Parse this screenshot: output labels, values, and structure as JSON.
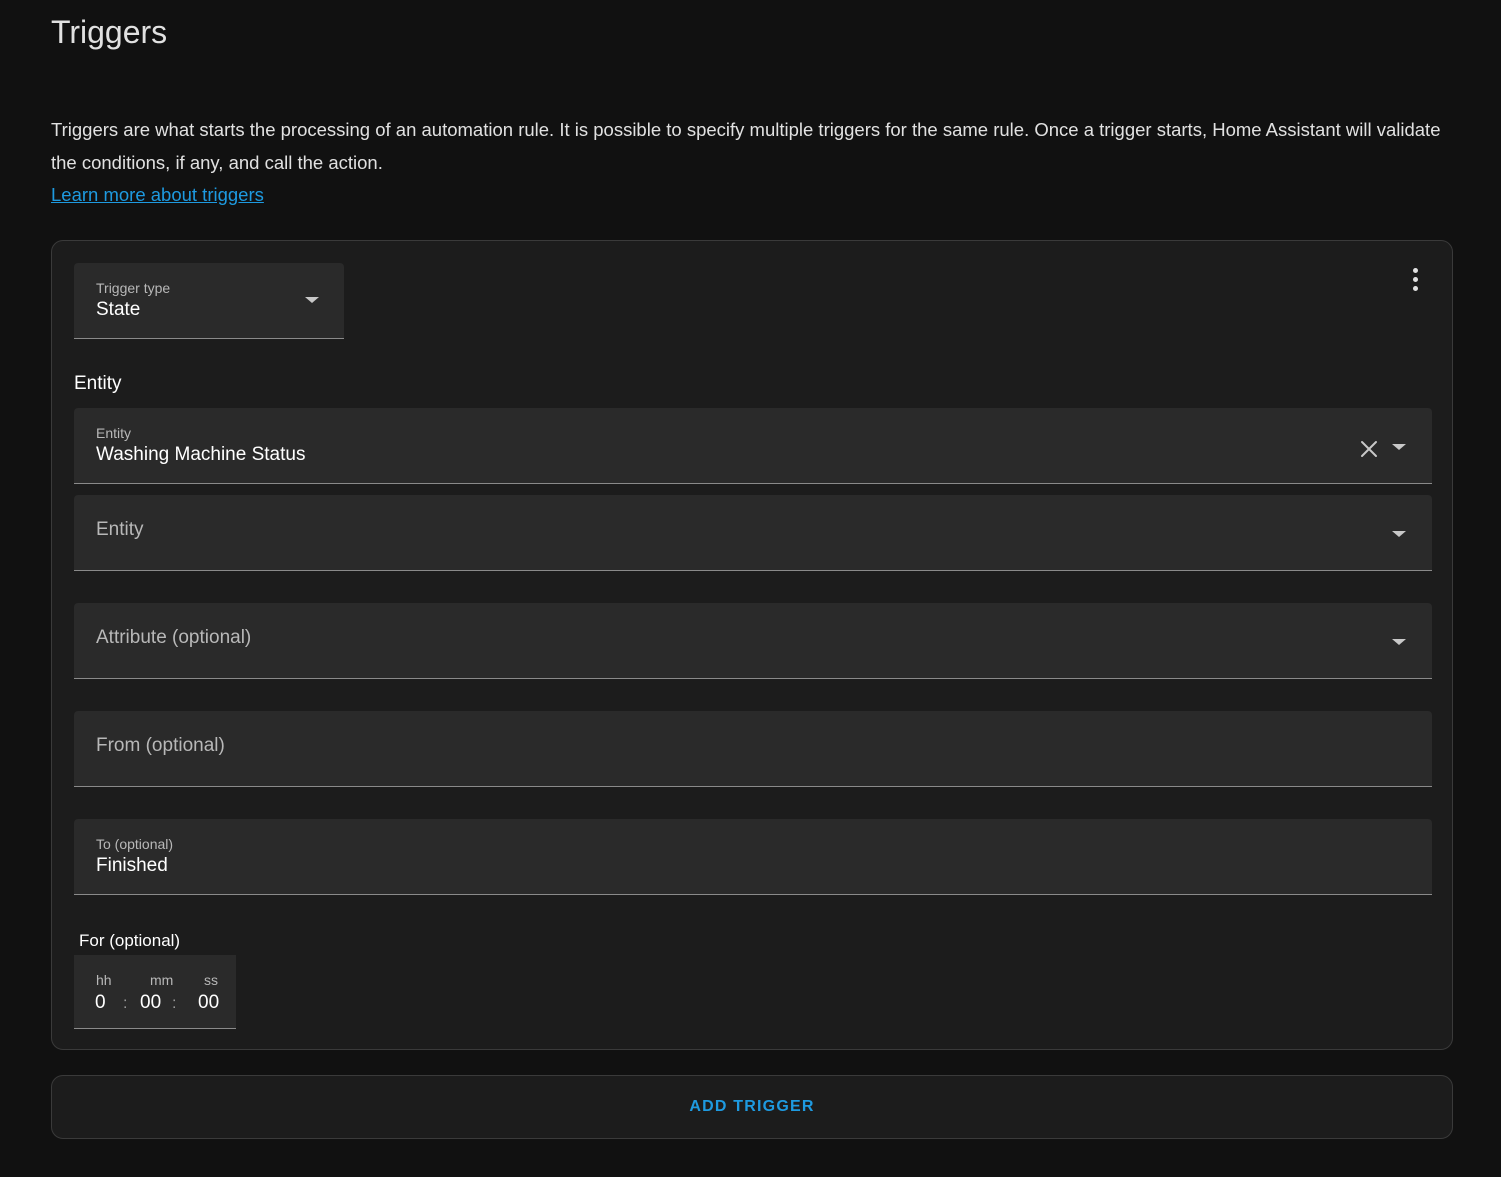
{
  "header": {
    "title": "Triggers"
  },
  "intro": {
    "description": "Triggers are what starts the processing of an automation rule. It is possible to specify multiple triggers for the same rule. Once a trigger starts, Home Assistant will validate the conditions, if any, and call the action.",
    "learn_more": "Learn more about triggers"
  },
  "trigger": {
    "type_label": "Trigger type",
    "type_value": "State",
    "entity_section_label": "Entity",
    "entity_selected_label": "Entity",
    "entity_selected_value": "Washing Machine Status",
    "entity_add_placeholder": "Entity",
    "attribute_placeholder": "Attribute (optional)",
    "from_placeholder": "From (optional)",
    "to_label": "To (optional)",
    "to_value": "Finished",
    "for_label": "For (optional)",
    "duration": {
      "hh_label": "hh",
      "mm_label": "mm",
      "ss_label": "ss",
      "hh": "0",
      "mm": "00",
      "ss": "00",
      "separator": ":"
    }
  },
  "actions": {
    "add_trigger": "ADD TRIGGER"
  },
  "icons": {
    "more": "dots-vertical-icon",
    "clear": "close-icon",
    "dropdown": "menu-down-icon"
  }
}
